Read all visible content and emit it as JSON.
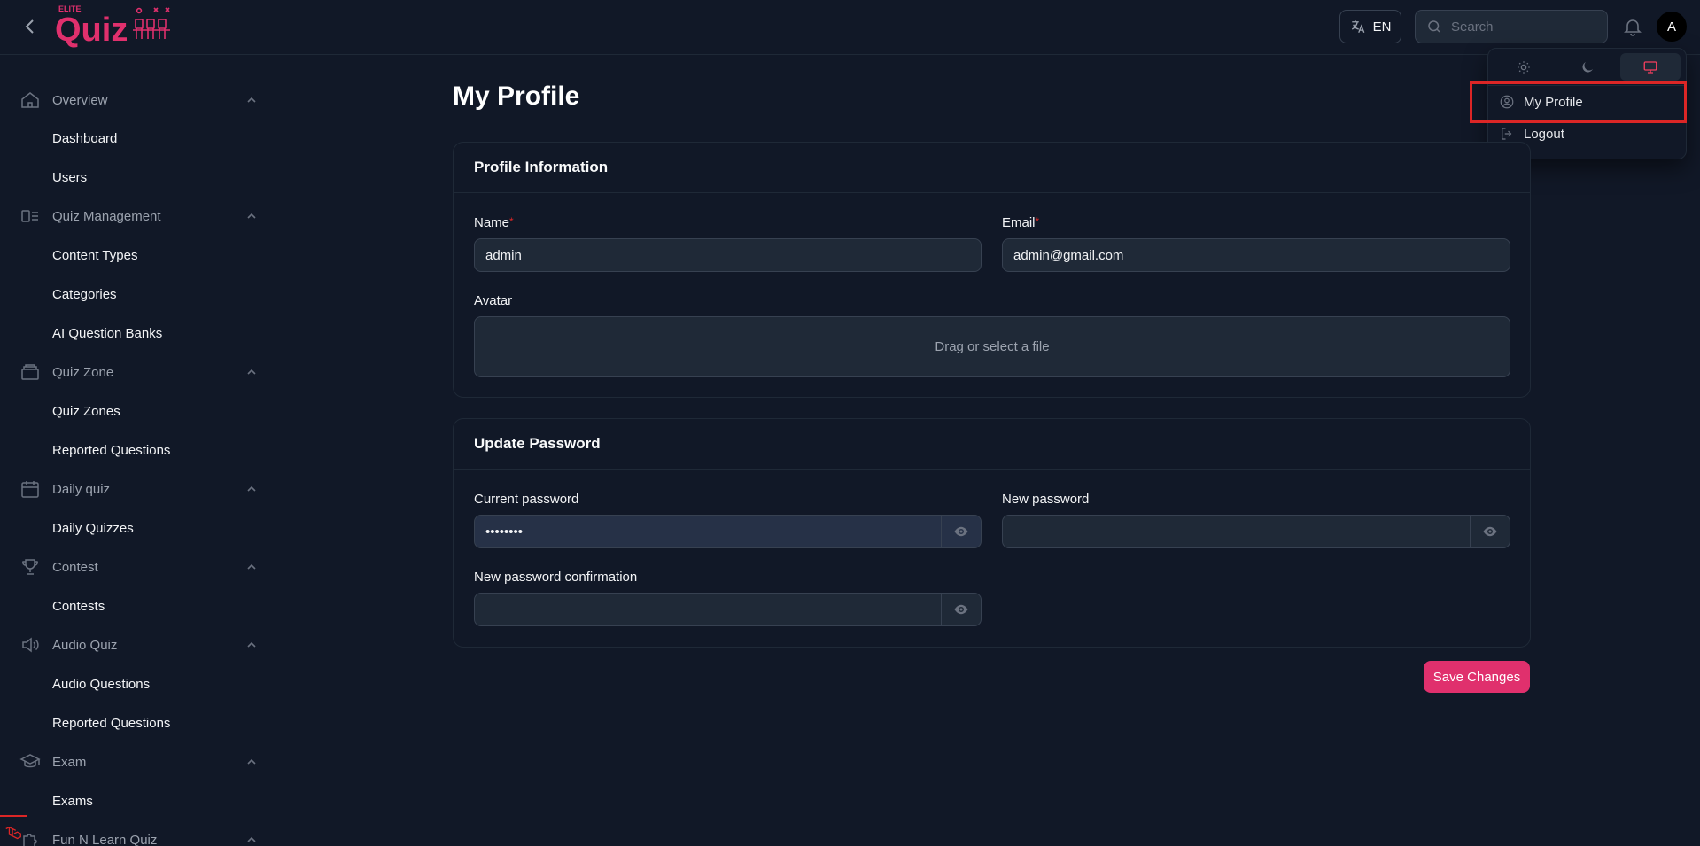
{
  "header": {
    "logo_top": "ELITE",
    "logo_main": "Quiz",
    "language": "EN",
    "search_placeholder": "Search",
    "avatar_initial": "A"
  },
  "user_menu": {
    "items": [
      {
        "label": "My Profile",
        "icon": "user-circle-icon"
      },
      {
        "label": "Logout",
        "icon": "logout-icon"
      }
    ],
    "theme_options": [
      "light",
      "dark",
      "system"
    ],
    "active_theme": "system"
  },
  "sidebar": {
    "groups": [
      {
        "label": "Overview",
        "icon": "home-icon",
        "items": [
          "Dashboard",
          "Users"
        ]
      },
      {
        "label": "Quiz Management",
        "icon": "layout-icon",
        "items": [
          "Content Types",
          "Categories",
          "AI Question Banks"
        ]
      },
      {
        "label": "Quiz Zone",
        "icon": "archive-icon",
        "items": [
          "Quiz Zones",
          "Reported Questions"
        ]
      },
      {
        "label": "Daily quiz",
        "icon": "calendar-icon",
        "items": [
          "Daily Quizzes"
        ]
      },
      {
        "label": "Contest",
        "icon": "trophy-icon",
        "items": [
          "Contests"
        ]
      },
      {
        "label": "Audio Quiz",
        "icon": "speaker-icon",
        "items": [
          "Audio Questions",
          "Reported Questions"
        ]
      },
      {
        "label": "Exam",
        "icon": "graduation-cap-icon",
        "items": [
          "Exams"
        ]
      },
      {
        "label": "Fun N Learn Quiz",
        "icon": "puzzle-icon",
        "items": []
      }
    ]
  },
  "main": {
    "title": "My Profile",
    "profile_card": {
      "title": "Profile Information",
      "name_label": "Name",
      "name_value": "admin",
      "email_label": "Email",
      "email_value": "admin@gmail.com",
      "avatar_label": "Avatar",
      "dropzone_text": "Drag or select a file"
    },
    "password_card": {
      "title": "Update Password",
      "current_label": "Current password",
      "current_value": "••••••••",
      "new_label": "New password",
      "confirm_label": "New password confirmation"
    },
    "save_label": "Save Changes"
  },
  "colors": {
    "background": "#111827",
    "accent": "#e0306d",
    "highlight": "#dc2626"
  }
}
